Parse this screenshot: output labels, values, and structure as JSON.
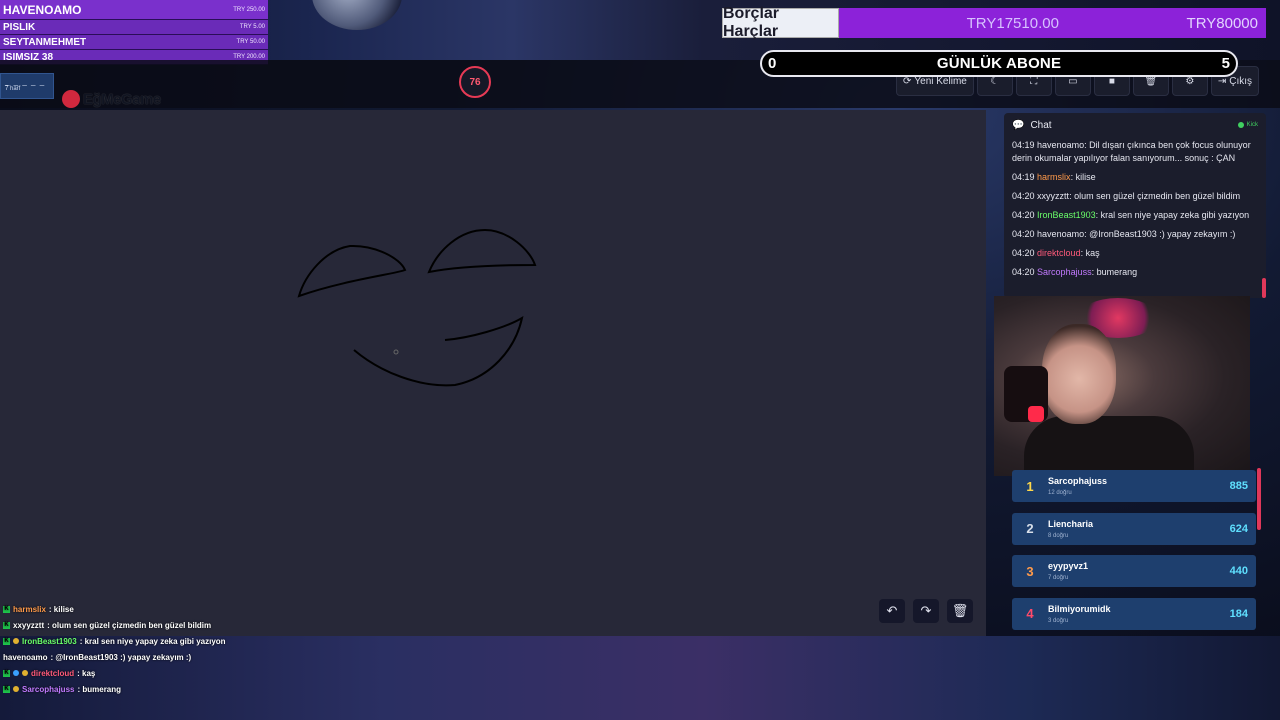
{
  "donations": [
    {
      "name": "HAVENOAMO",
      "amount": "TRY 250.00"
    },
    {
      "name": "PISLIK",
      "amount": "TRY 5.00"
    },
    {
      "name": "SEYTANMEHMET",
      "amount": "TRY 50.00"
    },
    {
      "name": "ISIMSIZ 38",
      "amount": "TRY 200.00"
    }
  ],
  "word_hint": {
    "dashes": "_ _ _ _ _",
    "label": "7 harf"
  },
  "logo_text": "EğMeGame",
  "timer": "76",
  "toolbar": {
    "new_word": "Yeni Kelime",
    "exit": "Çıkış"
  },
  "goal": {
    "title": "Borçlar Harçlar",
    "current": "TRY17510.00",
    "target": "TRY80000"
  },
  "sub_goal": {
    "start": "0",
    "label": "GÜNLÜK ABONE",
    "end": "5"
  },
  "chat": {
    "title": "Chat",
    "platform": "Kick",
    "messages": [
      {
        "time": "04:19",
        "user": "havenoamo",
        "text": "Dil dışarı çıkınca ben çok focus olunuyor derin okumalar yapılıyor falan sanıyorum... sonuç : ÇAN",
        "color": "#e6e7f0"
      },
      {
        "time": "04:19",
        "user": "harmslix",
        "text": "kilise",
        "color": "#ff9a4a"
      },
      {
        "time": "04:20",
        "user": "xxyyzztt",
        "text": "olum sen güzel çizmedin ben güzel bildim",
        "color": "#e6e7f0"
      },
      {
        "time": "04:20",
        "user": "IronBeast1903",
        "text": "kral sen niye yapay zeka gibi yazıyon",
        "color": "#6aff6a"
      },
      {
        "time": "04:20",
        "user": "havenoamo",
        "text": "@IronBeast1903 :) yapay zekayım :)",
        "color": "#e6e7f0"
      },
      {
        "time": "04:20",
        "user": "direktcloud",
        "text": "kaş",
        "color": "#ff5a7a"
      },
      {
        "time": "04:20",
        "user": "Sarcophajuss",
        "text": "bumerang",
        "color": "#c27aff"
      }
    ]
  },
  "leaderboard": [
    {
      "rank": "1",
      "name": "Sarcophajuss",
      "sub": "12 doğru",
      "score": "885",
      "rank_color": "#ffd84a"
    },
    {
      "rank": "2",
      "name": "Liencharia",
      "sub": "8 doğru",
      "score": "624",
      "rank_color": "#d8dfe9"
    },
    {
      "rank": "3",
      "name": "eyypyvz1",
      "sub": "7 doğru",
      "score": "440",
      "rank_color": "#ff9a4a"
    },
    {
      "rank": "4",
      "name": "Bilmiyorumidk",
      "sub": "3 doğru",
      "score": "184",
      "rank_color": "#ff4a6a"
    }
  ],
  "overlay_chat": [
    {
      "user": "harmslix",
      "text": ": kilise",
      "color": "#ff9a4a"
    },
    {
      "user": "xxyyzztt",
      "text": ": olum sen güzel çizmedin ben güzel bildim",
      "color": "#ffffff"
    },
    {
      "user": "IronBeast1903",
      "text": ": kral sen niye yapay zeka gibi yazıyon",
      "color": "#6aff6a"
    },
    {
      "user": "havenoamo",
      "text": ": @IronBeast1903 :) yapay zekayım :)",
      "color": "#ffffff"
    },
    {
      "user": "direktcloud",
      "text": ": kaş",
      "color": "#ff5a7a"
    },
    {
      "user": "Sarcophajuss",
      "text": ": bumerang",
      "color": "#c27aff"
    }
  ]
}
